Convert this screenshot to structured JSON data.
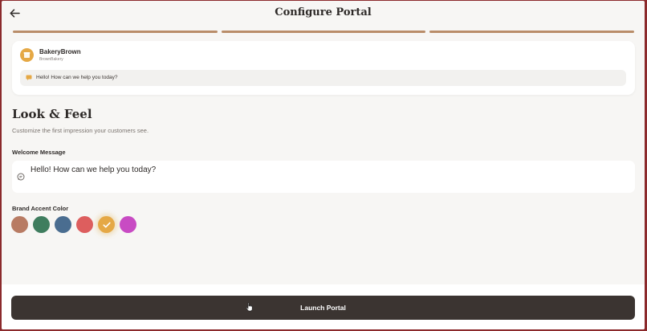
{
  "header": {
    "title": "Configure Portal",
    "back_icon": "arrow-left-icon"
  },
  "progress": {
    "total_steps": 3,
    "completed_steps": 3,
    "color": "#b98d69"
  },
  "preview": {
    "brand_name": "BakeryBrown",
    "brand_handle": "BrownBakery",
    "brand_icon": "store-icon",
    "message": "Hello! How can we help you today?",
    "message_icon": "chat-bubble-icon"
  },
  "section": {
    "title": "Look & Feel",
    "subtitle": "Customize the first impression your customers see."
  },
  "welcome": {
    "label": "Welcome Message",
    "value": "Hello! How can we help you today?",
    "icon": "chat-bubble-icon"
  },
  "accent": {
    "label": "Brand Accent Color",
    "colors": [
      "#b87b63",
      "#3f7d5e",
      "#4a6d90",
      "#dd5e5e",
      "#e5a845",
      "#c84bc3"
    ],
    "selected_index": 4
  },
  "footer": {
    "launch_label": "Launch Portal"
  }
}
